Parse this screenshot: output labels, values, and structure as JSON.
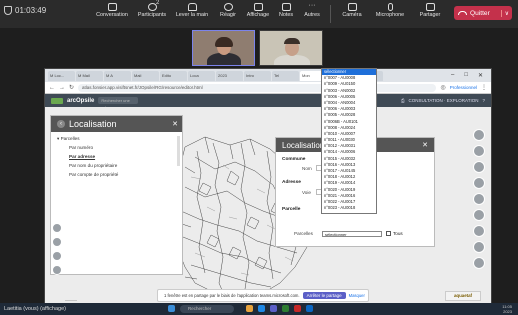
{
  "meeting": {
    "timer": "01:03:49",
    "toolbar": [
      {
        "label": "Conversation",
        "badge": ""
      },
      {
        "label": "Participants",
        "badge": "2"
      },
      {
        "label": "Lever la main",
        "badge": ""
      },
      {
        "label": "Réagir",
        "badge": ""
      },
      {
        "label": "Affichage",
        "badge": ""
      },
      {
        "label": "Notes",
        "badge": ""
      },
      {
        "label": "Autres",
        "badge": ""
      },
      {
        "label": "Caméra",
        "badge": ""
      },
      {
        "label": "Microphone",
        "badge": ""
      },
      {
        "label": "Partager",
        "badge": ""
      }
    ],
    "quit_label": "Quitter",
    "presenter_label": "Laetitia (vous) (affichage)"
  },
  "browser": {
    "tabs": [
      "M Loc...",
      "M Mail",
      "M A",
      "Mail",
      "Edito",
      "Loca",
      "2023",
      "Intro",
      "Tel",
      "Mon",
      "Sans",
      "Mon"
    ],
    "url": "atlas.fonsier.app.visiftsnet.fr/JOpsile/RG/resource/editor.html",
    "profile": "Professionnel"
  },
  "app": {
    "name": "arcOpsile",
    "search_placeholder": "Rechercher une adresse",
    "header_right": "CONSULTATION · EXPLORATION"
  },
  "localisation": {
    "title": "Localisation",
    "section": "Parcelles",
    "items": [
      "Par numéro",
      "Par adresse",
      "Par nom du propriétaire",
      "Par compte de propriété"
    ],
    "selected_index": 1
  },
  "parcel_form": {
    "title": "Localisation par voie",
    "commune_label": "Commune",
    "nom_label": "Nom",
    "adresse_label": "Adresse",
    "voie_label": "Voie",
    "parcelle_label": "Parcelle",
    "parcelles_label": "Parcelles",
    "select_value": "sélectionner",
    "tous_label": "Tous"
  },
  "parcel_dropdown": {
    "highlighted_index": 0,
    "options": [
      "sélectionner",
      "n°0007 - AU0008",
      "n°0009 - AU0150",
      "n°0003 - AN0002",
      "n°0006 - AU0005",
      "n°0004 - AN0004",
      "n°0006 - AU0003",
      "n°0005 - AU0028",
      "n°0006B - AU0101",
      "n°0008 - AU0024",
      "n°0010 - AU0007",
      "n°0011 - AU0030",
      "n°0012 - AU0031",
      "n°0014 - AU0006",
      "n°0015 - AU0032",
      "n°0016 - AU0013",
      "n°0017 - AU0145",
      "n°0018 - AU0012",
      "n°0019 - AU0014",
      "n°0020 - AU0019",
      "n°0021 - AU0016",
      "n°0022 - AU0017",
      "n°0023 - AU0018"
    ]
  },
  "share_notice": {
    "text": "1 fenêtre est en partage par le biais de l'application teams.microsoft.com.",
    "stop_label": "Arrêter le partage",
    "hide_label": "Masquer"
  },
  "brand_badge": "aquaetaf",
  "taskbar": {
    "search_placeholder": "Rechercher",
    "time": "11:05",
    "date": "2023"
  }
}
